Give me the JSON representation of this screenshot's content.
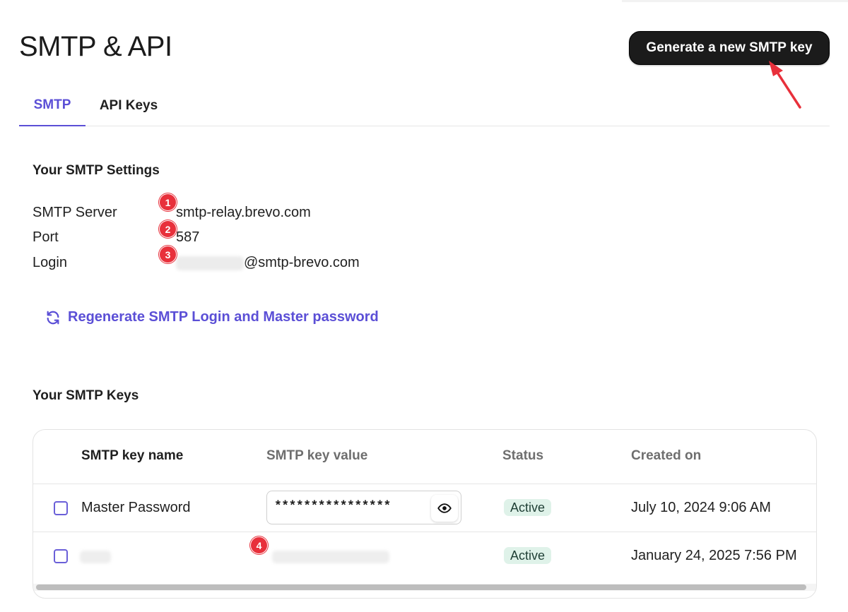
{
  "page": {
    "title": "SMTP & API",
    "generate_button": "Generate a new SMTP key"
  },
  "tabs": [
    {
      "label": "SMTP",
      "active": true
    },
    {
      "label": "API Keys",
      "active": false
    }
  ],
  "settings": {
    "section_title": "Your SMTP Settings",
    "rows": [
      {
        "label": "SMTP Server",
        "value": "smtp-relay.brevo.com",
        "marker": "1"
      },
      {
        "label": "Port",
        "value": "587",
        "marker": "2"
      },
      {
        "label": "Login",
        "value": "@smtp-brevo.com",
        "marker": "3"
      }
    ],
    "regenerate_link": "Regenerate SMTP Login and Master password"
  },
  "keys": {
    "section_title": "Your SMTP Keys",
    "columns": [
      "SMTP key name",
      "SMTP key value",
      "Status",
      "Created on"
    ],
    "rows": [
      {
        "name": "Master Password",
        "value": "****************",
        "status": "Active",
        "created": "July 10, 2024 9:06 AM"
      },
      {
        "name": "",
        "value": "",
        "status": "Active",
        "created": "January 24, 2025 7:56 PM",
        "marker": "4"
      }
    ]
  },
  "colors": {
    "accent": "#5b4fd6",
    "marker": "#e8303b",
    "status_bg": "#dff2e9",
    "button_bg": "#1b1b1b"
  },
  "icons": {
    "regenerate": "refresh-icon",
    "reveal": "eye-icon",
    "annotation": "red-arrow-icon"
  }
}
